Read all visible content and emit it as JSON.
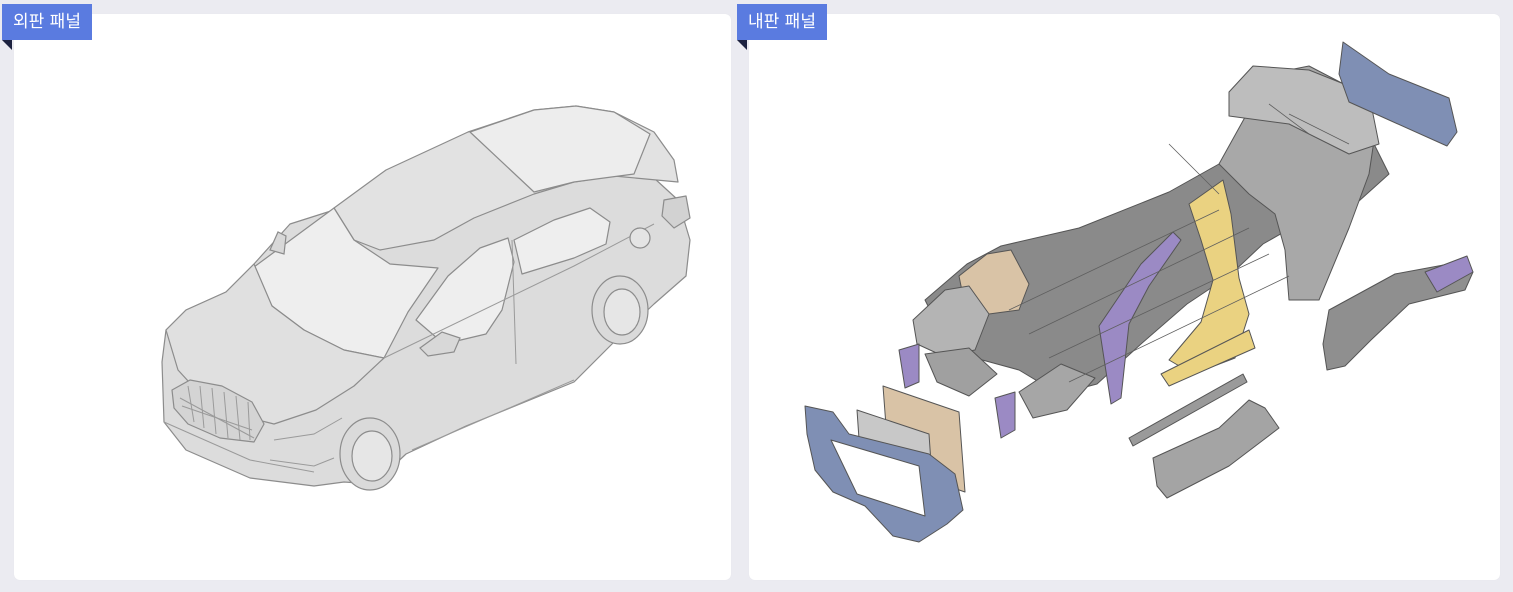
{
  "panels": {
    "outer": {
      "label": "외판 패널",
      "image": "car-exterior-body-illustration"
    },
    "inner": {
      "label": "내판 패널",
      "image": "car-body-in-white-exploded-illustration"
    }
  },
  "colors": {
    "background": "#ebebf1",
    "card": "#ffffff",
    "label_bg": "#5a7be0",
    "label_text": "#ffffff",
    "part_blue": "#7f8fb4",
    "part_purple": "#9b8ac4",
    "part_yellow": "#ead281",
    "part_tan": "#d9c3a6",
    "part_gray": "#8c8c8c"
  }
}
